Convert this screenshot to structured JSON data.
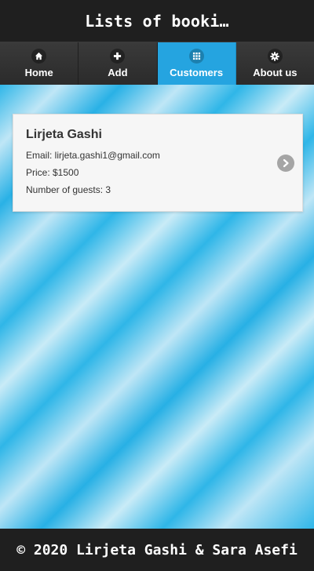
{
  "header": {
    "title": "Lists of booki…"
  },
  "navbar": {
    "items": [
      {
        "label": "Home",
        "icon": "home-icon"
      },
      {
        "label": "Add",
        "icon": "plus-icon"
      },
      {
        "label": "Customers",
        "icon": "grid-icon"
      },
      {
        "label": "About us",
        "icon": "gear-icon"
      }
    ],
    "active_index": 2,
    "accent_color": "#25a4e0"
  },
  "bookings": [
    {
      "name": "Lirjeta Gashi",
      "email": "Email: lirjeta.gashi1@gmail.com",
      "price": "Price: $1500",
      "guests": "Number of guests: 3"
    }
  ],
  "footer": {
    "text": "© 2020 Lirjeta Gashi & Sara Asefi"
  }
}
